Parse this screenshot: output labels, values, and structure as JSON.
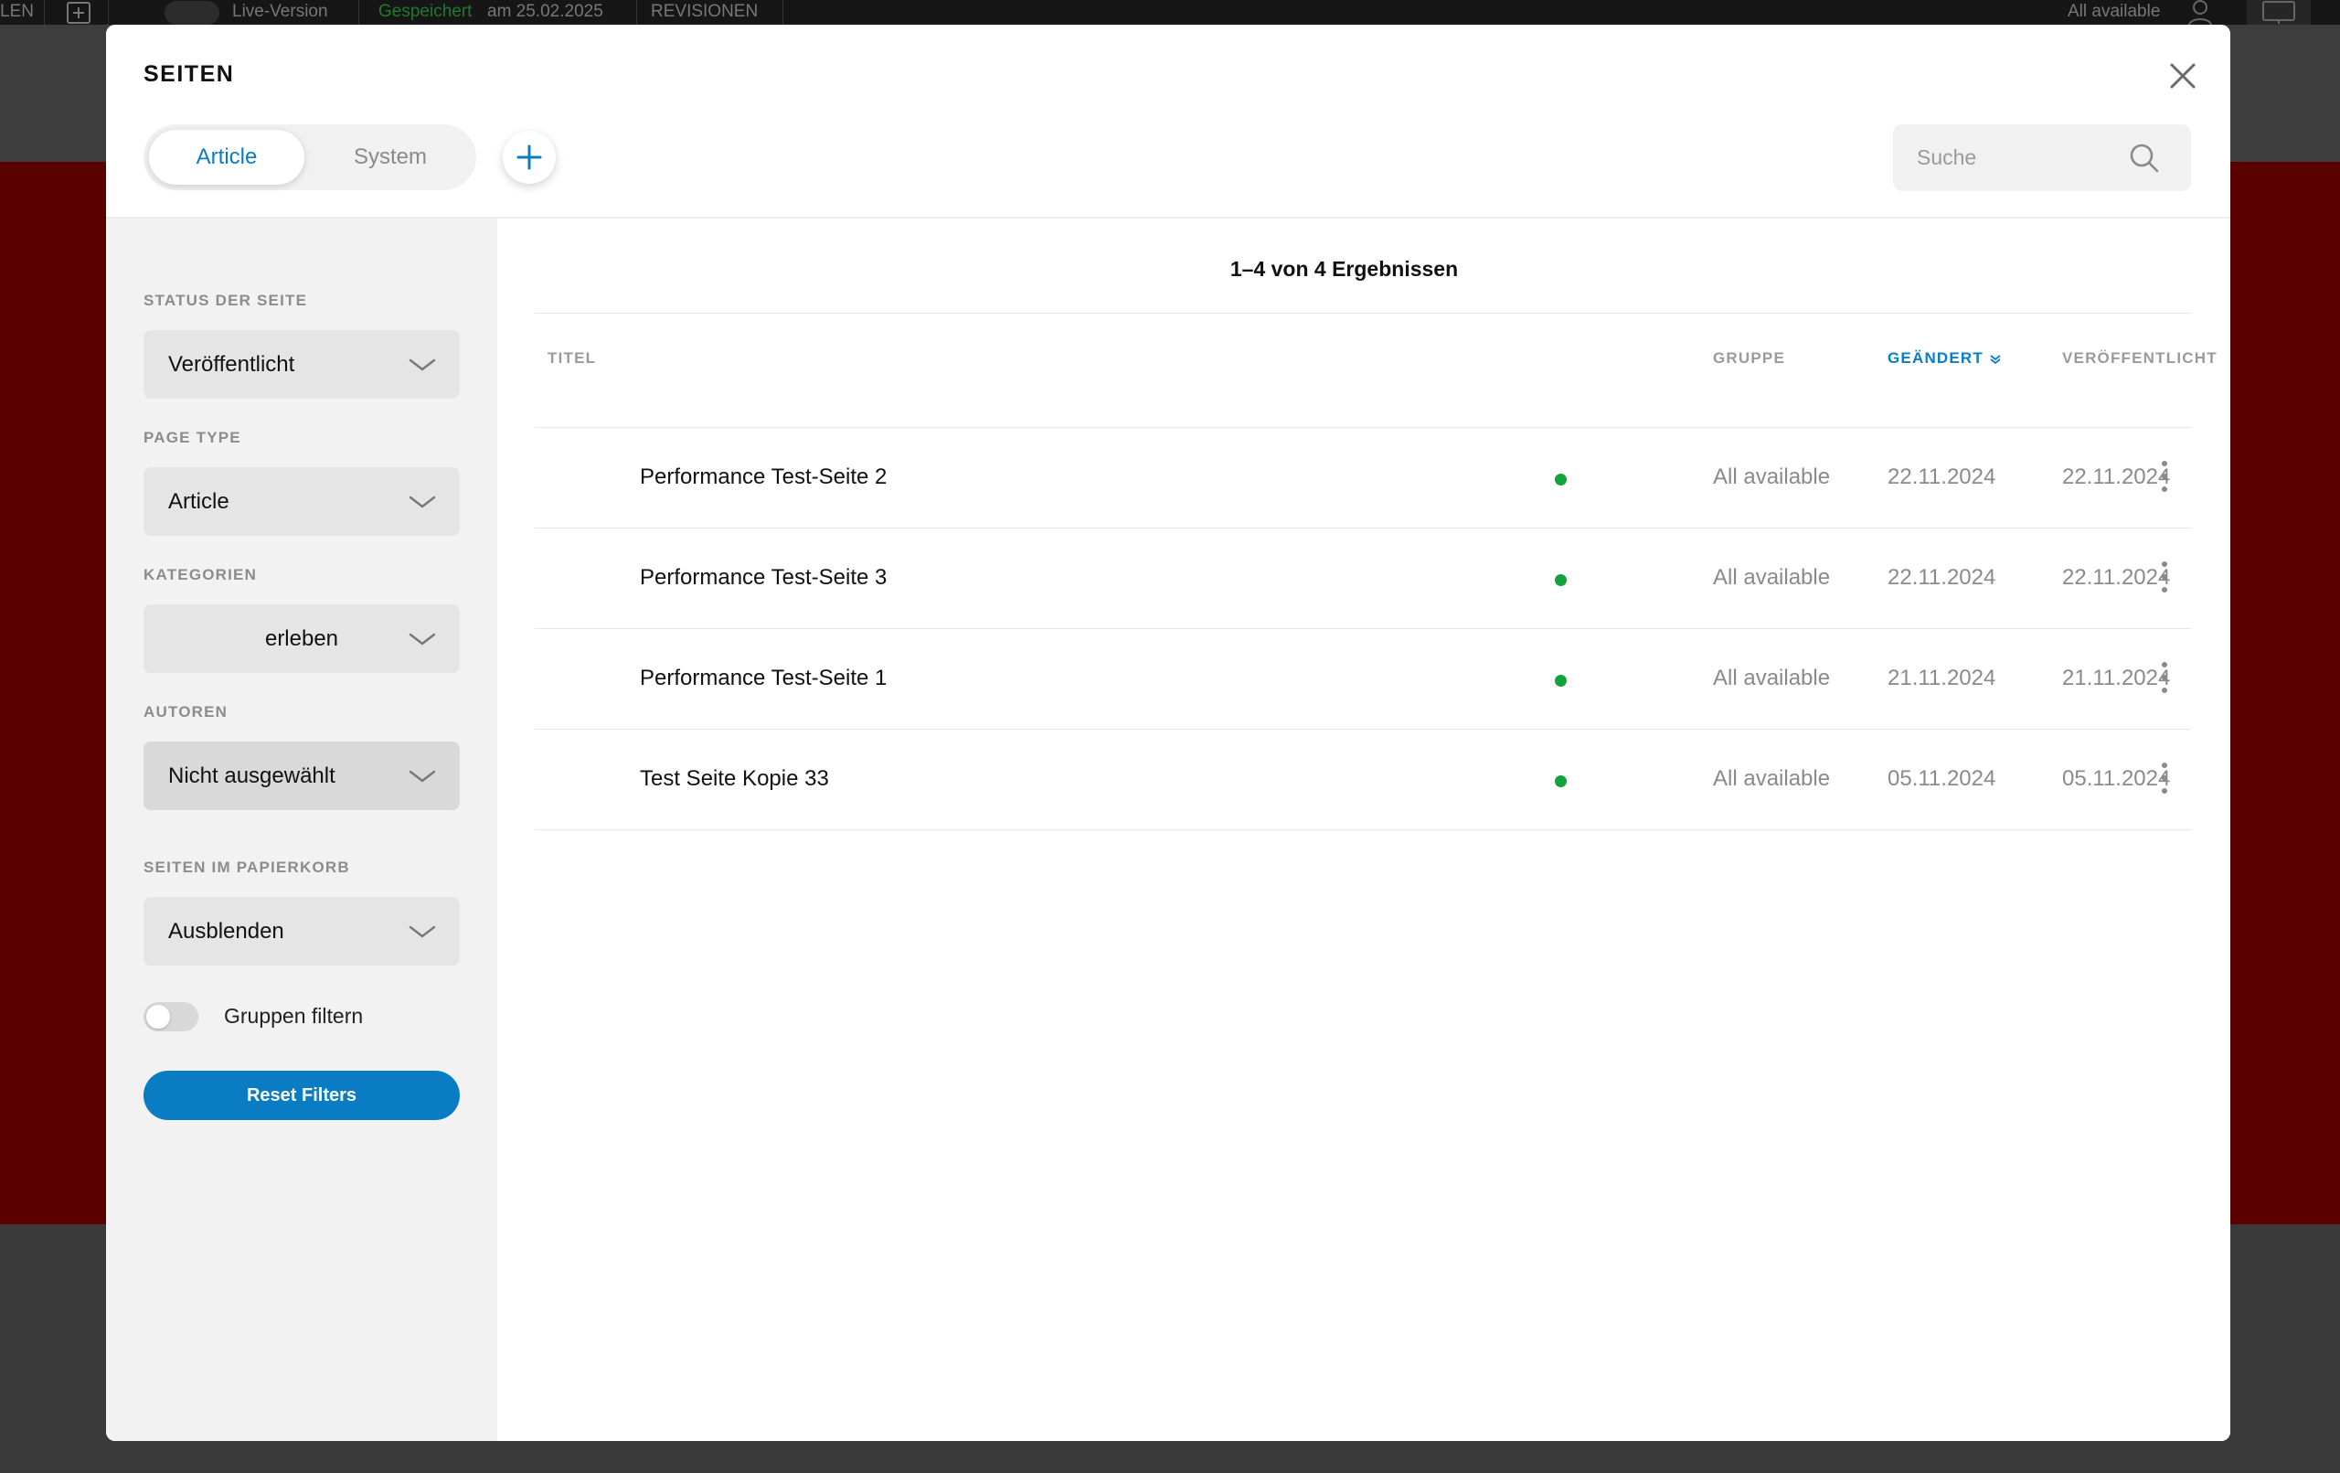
{
  "background": {
    "topbar": {
      "left_text": "LEN",
      "live_label": "Live-Version",
      "saved_status": "Gespeichert",
      "saved_date": "am 25.02.2025",
      "revisions": "REVISIONEN",
      "group": "All available"
    }
  },
  "modal": {
    "title": "SEITEN",
    "tabs": [
      {
        "label": "Article",
        "active": true
      },
      {
        "label": "System",
        "active": false
      }
    ],
    "search_placeholder": "Suche"
  },
  "filters": {
    "status": {
      "label": "STATUS DER SEITE",
      "value": "Veröffentlicht"
    },
    "page_type": {
      "label": "PAGE TYPE",
      "value": "Article"
    },
    "categories": {
      "label": "KATEGORIEN",
      "value": "erleben"
    },
    "authors": {
      "label": "AUTOREN",
      "value": "Nicht ausgewählt"
    },
    "trash": {
      "label": "SEITEN IM PAPIERKORB",
      "value": "Ausblenden"
    },
    "group_toggle": {
      "label": "Gruppen filtern",
      "on": false
    },
    "reset_label": "Reset Filters"
  },
  "results": {
    "summary": "1–4 von 4 Ergebnissen",
    "columns": {
      "title": "TITEL",
      "group": "GRUPPE",
      "changed": "GEÄNDERT",
      "published": "VERÖFFENTLICHT"
    },
    "rows": [
      {
        "title": "Performance Test-Seite 2",
        "group": "All available",
        "changed": "22.11.2024",
        "published": "22.11.2024"
      },
      {
        "title": "Performance Test-Seite 3",
        "group": "All available",
        "changed": "22.11.2024",
        "published": "22.11.2024"
      },
      {
        "title": "Performance Test-Seite 1",
        "group": "All available",
        "changed": "21.11.2024",
        "published": "21.11.2024"
      },
      {
        "title": "Test Seite Kopie 33",
        "group": "All available",
        "changed": "05.11.2024",
        "published": "05.11.2024"
      }
    ]
  },
  "colors": {
    "accent": "#0a7cc4",
    "status_online": "#12a33a"
  }
}
